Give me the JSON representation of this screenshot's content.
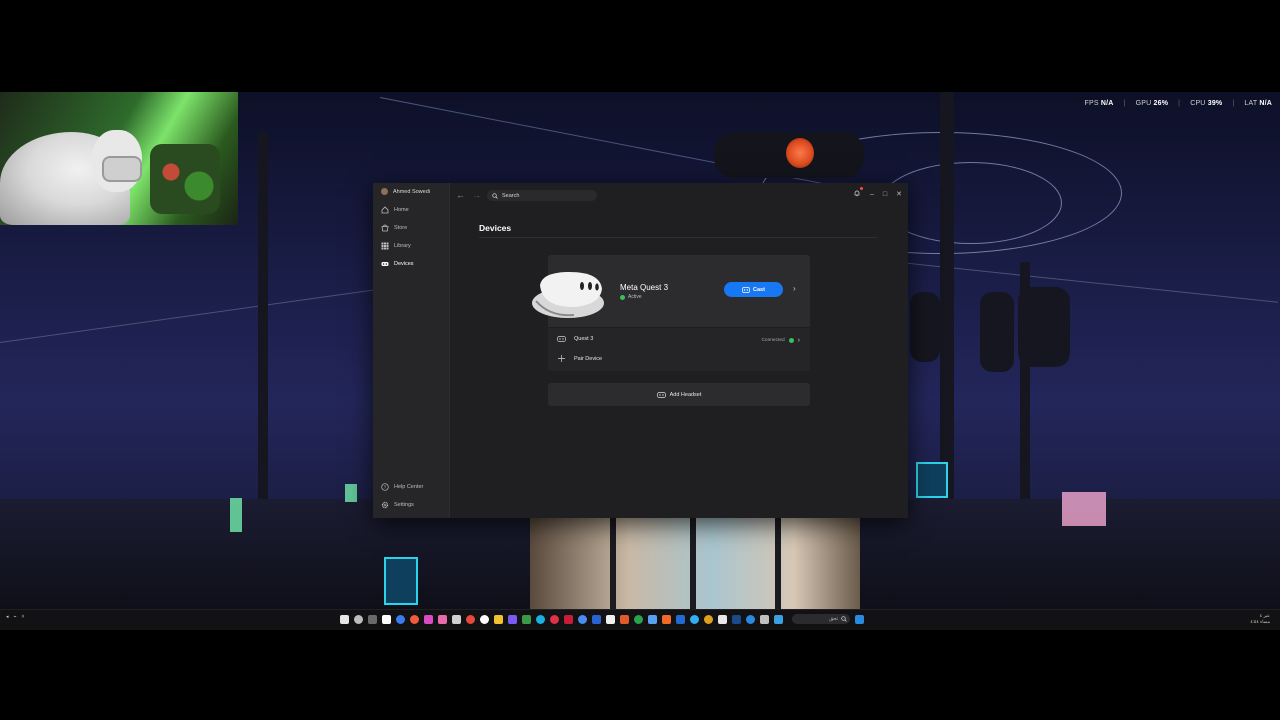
{
  "overlay": {
    "fps_label": "FPS",
    "fps_value": "N/A",
    "gpu_label": "GPU",
    "gpu_value": "26%",
    "cpu_label": "CPU",
    "cpu_value": "39%",
    "lat_label": "LAT",
    "lat_value": "N/A"
  },
  "app": {
    "profile_name": "Ahmed Sowedi",
    "sidebar": {
      "items": [
        {
          "label": "Home",
          "icon": "home-icon"
        },
        {
          "label": "Store",
          "icon": "store-icon"
        },
        {
          "label": "Library",
          "icon": "grid-icon"
        },
        {
          "label": "Devices",
          "icon": "headset-icon"
        }
      ],
      "footer": [
        {
          "label": "Help Center",
          "icon": "help-icon"
        },
        {
          "label": "Settings",
          "icon": "gear-icon"
        }
      ]
    },
    "search": {
      "placeholder": "Search"
    },
    "page_title": "Devices",
    "device": {
      "name": "Meta Quest 3",
      "status": "Active",
      "cast_label": "Cast"
    },
    "device_list": {
      "headset_name": "Quest 3",
      "connection_status": "Connected",
      "pair_label": "Pair Device"
    },
    "add_headset_label": "Add Headset",
    "accent": "#1877f2",
    "status_color": "#37c15a"
  },
  "webcam": {
    "icon": "webcam-feed"
  },
  "taskbar": {
    "search_text": "تحق",
    "clock_line1": "عبر ٤",
    "clock_line2": "مساء ٤:٥٤"
  }
}
